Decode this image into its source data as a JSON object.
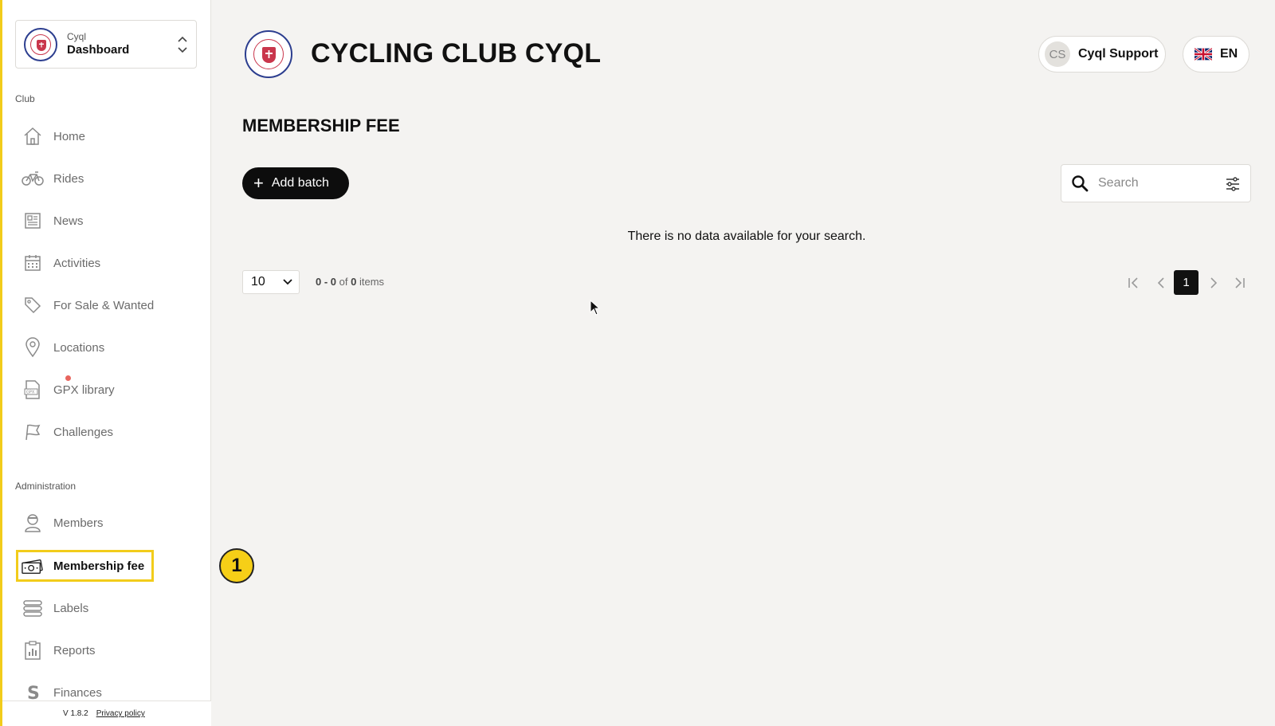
{
  "sidebar": {
    "club_switcher": {
      "small": "Cyql",
      "big": "Dashboard"
    },
    "sections": {
      "club": "Club",
      "administration": "Administration"
    },
    "club_items": [
      {
        "label": "Home",
        "icon": "home-icon"
      },
      {
        "label": "Rides",
        "icon": "bicycle-icon"
      },
      {
        "label": "News",
        "icon": "newspaper-icon"
      },
      {
        "label": "Activities",
        "icon": "calendar-icon"
      },
      {
        "label": "For Sale & Wanted",
        "icon": "tag-icon"
      },
      {
        "label": "Locations",
        "icon": "map-pin-icon"
      },
      {
        "label": "GPX library",
        "icon": "gpx-file-icon"
      },
      {
        "label": "Challenges",
        "icon": "flag-icon"
      }
    ],
    "admin_items": [
      {
        "label": "Members",
        "icon": "member-icon"
      },
      {
        "label": "Membership fee",
        "icon": "money-icon",
        "active": true
      },
      {
        "label": "Labels",
        "icon": "labels-icon"
      },
      {
        "label": "Reports",
        "icon": "report-icon"
      },
      {
        "label": "Finances",
        "icon": "finances-icon"
      }
    ],
    "footer": {
      "version": "V 1.8.2",
      "privacy": "Privacy policy"
    }
  },
  "header": {
    "club_title": "CYCLING CLUB CYQL",
    "user": {
      "initials": "CS",
      "name": "Cyql Support"
    },
    "language": {
      "code": "EN",
      "flag": "uk-flag-icon"
    }
  },
  "main": {
    "page_title": "MEMBERSHIP FEE",
    "add_button": "Add batch",
    "search": {
      "placeholder": "Search",
      "value": ""
    },
    "empty_message": "There is no data available for your search.",
    "pagination": {
      "page_size": "10",
      "range": "0 - 0",
      "of": "of",
      "total": "0",
      "items_word": "items",
      "current_page": "1"
    }
  },
  "annotation": {
    "step": "1"
  },
  "colors": {
    "highlight": "#f2cc1b",
    "primary": "#0d0d0d",
    "background": "#f4f3f1",
    "notification": "#e8655e"
  }
}
